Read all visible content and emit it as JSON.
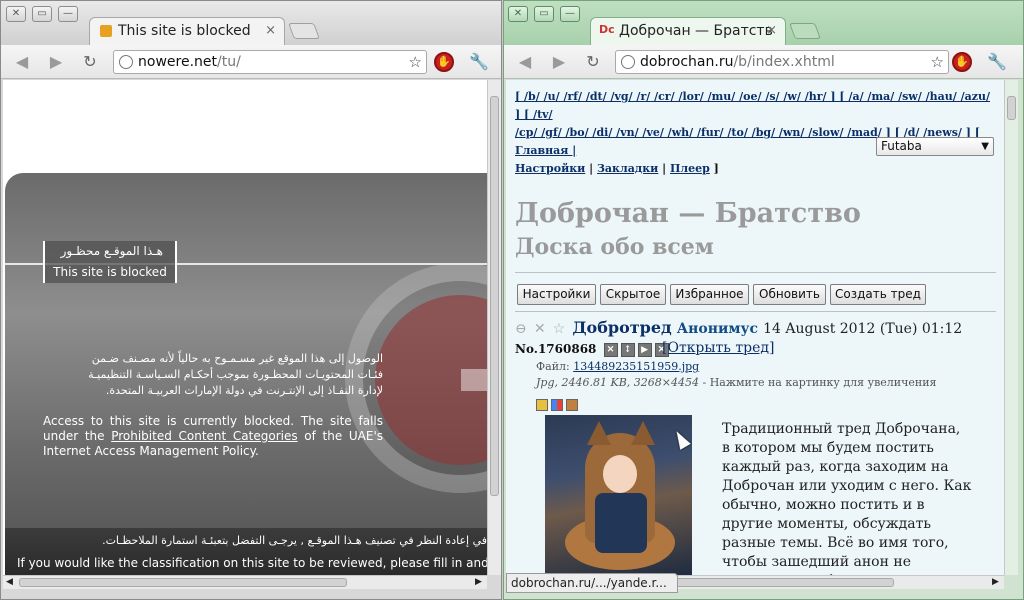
{
  "left_window": {
    "controls": {
      "close": "✕",
      "maximize": "▭",
      "minimize": "—"
    },
    "tab": {
      "title": "This site is blocked",
      "close": "×"
    },
    "toolbar": {
      "back": "◀",
      "forward": "▶",
      "reload": "↻",
      "url_host": "nowere.net",
      "url_path": "/tu/",
      "star": "☆",
      "stop": "✋",
      "wrench": "🔧"
    },
    "page": {
      "label_ar": "هـذا الموقـع محظـور",
      "label_en": "This site is blocked",
      "para_ar_1": "الوصول إلى هذا الموقع غير مسـمـوح به حالياً لأنه مصـنف ضـمن",
      "para_ar_2": "فئـات المحتويـات المحظـورة بموجب أحكـام السـياسـة التنظيميـة",
      "para_ar_3": "لإدارة النفـاذ إلى الإنتـرنت في دولة الإمارات العربيـة المتحدة.",
      "para_en_1": "Access to this site is currently blocked.  The site falls under the ",
      "para_en_link": "Prohibited Content Categories",
      "para_en_2": " of the UAE's Internet Access Management Policy.",
      "bottom_ar": "في إعادة النظر في تصنيف هـذا الموقـع , يرجـى التفضل بتعبئـة استمارة الملاحظـات.",
      "bottom_en": "If you would like the classification on this site to be reviewed, please fill in and submit"
    }
  },
  "right_window": {
    "controls": {
      "close": "✕",
      "maximize": "▭",
      "minimize": "—"
    },
    "tab": {
      "favicon": "Dc",
      "title": "Доброчан — Братств",
      "close": "×"
    },
    "toolbar": {
      "back": "◀",
      "forward": "▶",
      "reload": "↻",
      "url_host": "dobrochan.ru",
      "url_path": "/b/index.xhtml",
      "star": "☆",
      "stop": "✋",
      "wrench": "🔧"
    },
    "navlinks": {
      "line1": "[ /b/ /u/ /rf/ /dt/ /vg/ /r/ /cr/ /lor/ /mu/ /oe/ /s/ /w/ /hr/ ] [ /a/ /ma/ /sw/ /hau/ /azu/ ] [ /tv/",
      "line2": "/cp/ /gf/ /bo/ /di/ /vn/ /ve/ /wh/ /fur/ /to/ /bg/ /wn/ /slow/ /mad/ ] [ /d/ /news/ ] [ Главная |",
      "line3_a": "Настройки",
      "line3_b": "Закладки",
      "line3_c": "Плеер"
    },
    "style_select": "Futaba",
    "board_title": "Доброчан — Братство",
    "board_subtitle": "Доска обо всем",
    "buttons": [
      "Настройки",
      "Скрытое",
      "Избранное",
      "Обновить",
      "Создать тред"
    ],
    "post": {
      "title": "Добротред",
      "author": "Анонимус",
      "date": "14 August 2012 (Tue) 01:12",
      "number": "No.1760868",
      "open_thread": "[Открыть тред]",
      "file_label": "Файл: ",
      "file_name": "134489235151959.jpg",
      "file_info": "Jpg, 2446.81 KB, 3268×4454",
      "file_hint": " - Нажмите на картинку для увеличения",
      "text": "Традиционный тред Доброчана, в котором мы будем постить каждый раз, когда заходим на Доброчан или уходим с него. Как обычно, можно постить и в другие моменты, обсуждать разные темы. Всё во имя того, чтобы зашедший анон не чувствовал себя одиноким. Главное"
    },
    "status_url": "dobrochan.ru/.../yande.r..."
  },
  "colors": {
    "block_red": "#c62020",
    "link_blue": "#0b2f66",
    "board_bg": "#edf7fa"
  }
}
